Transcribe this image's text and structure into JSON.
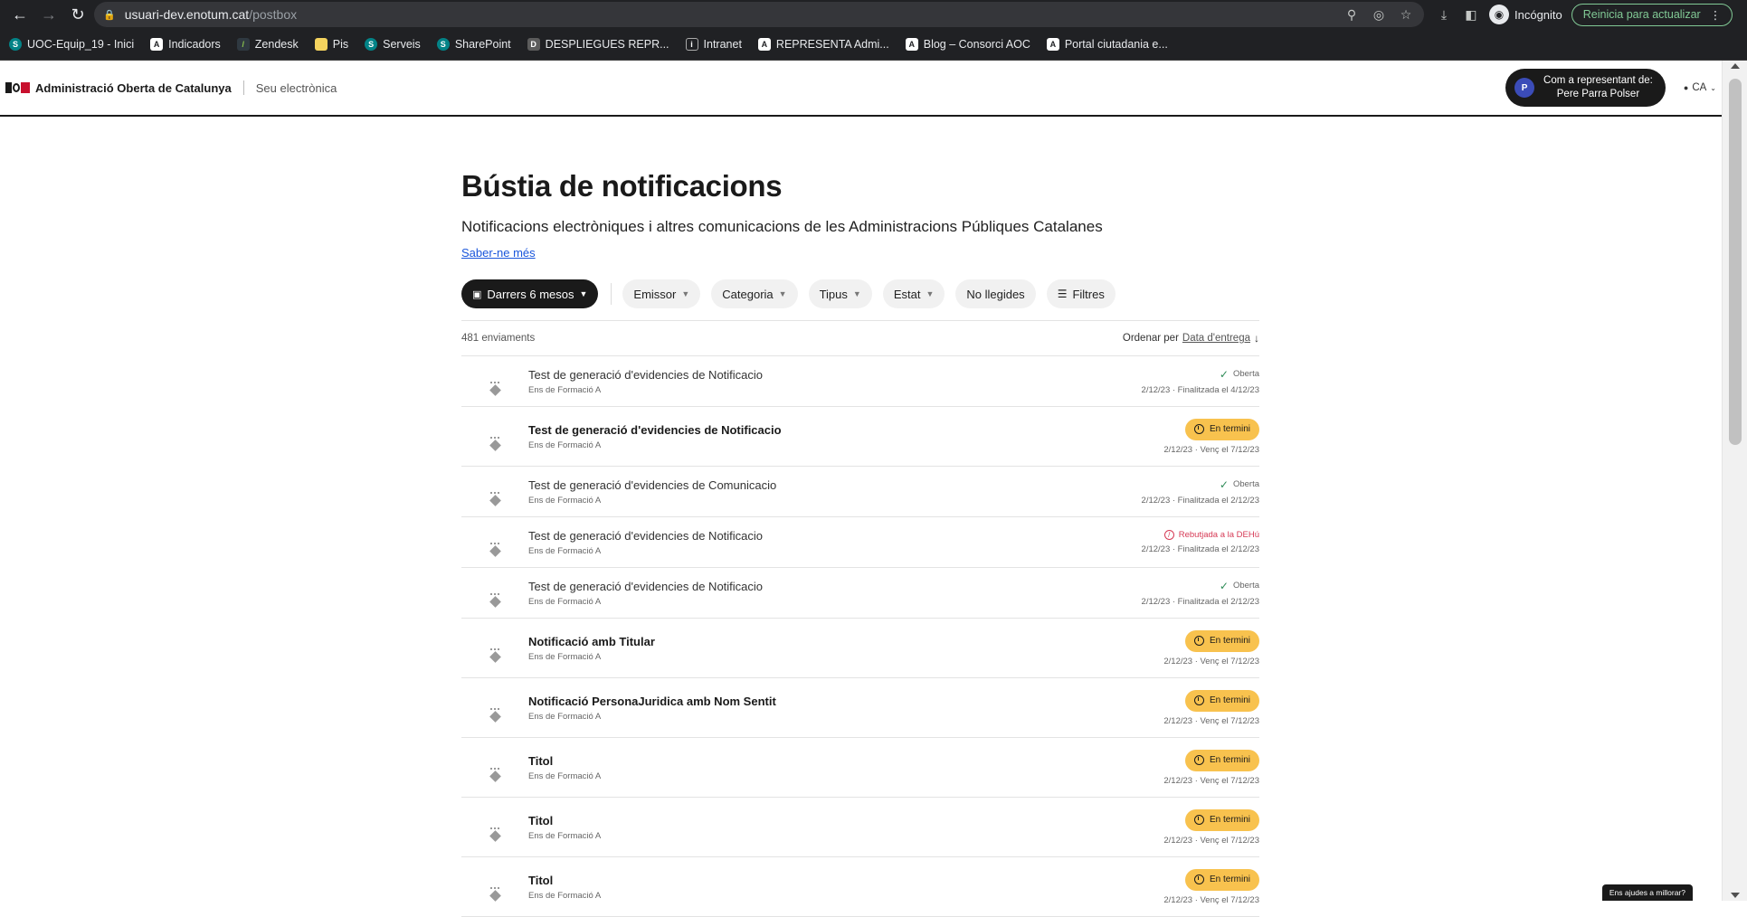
{
  "browser": {
    "url_host": "usuari-dev.enotum.cat",
    "url_path": "/postbox",
    "incognito_label": "Incógnito",
    "update_label": "Reinicia para actualizar",
    "bookmarks": [
      {
        "label": "UOC-Equip_19 - Inici",
        "icon": "sharepoint-icon"
      },
      {
        "label": "Indicadors",
        "icon": "aoc-icon"
      },
      {
        "label": "Zendesk",
        "icon": "zendesk-icon"
      },
      {
        "label": "Pis",
        "icon": "folder-icon"
      },
      {
        "label": "Serveis",
        "icon": "sharepoint-icon"
      },
      {
        "label": "SharePoint",
        "icon": "sharepoint-icon"
      },
      {
        "label": "DESPLIEGUES REPR...",
        "icon": "despliegues-icon"
      },
      {
        "label": "Intranet",
        "icon": "intranet-icon"
      },
      {
        "label": "REPRESENTA Admi...",
        "icon": "aoc-icon"
      },
      {
        "label": "Blog – Consorci AOC",
        "icon": "aoc-icon"
      },
      {
        "label": "Portal ciutadania e...",
        "icon": "aoc-icon"
      }
    ]
  },
  "header": {
    "org_name": "Administració Oberta de Catalunya",
    "org_sub": "Seu electrònica",
    "rep_line1": "Com a representant de:",
    "rep_line2": "Pere Parra Polser",
    "avatar_initial": "P",
    "lang": "CA"
  },
  "main": {
    "title": "Bústia de notificacions",
    "subtitle": "Notificacions electròniques i altres comunicacions de les Administracions Públiques Catalanes",
    "more_link": "Saber-ne més",
    "filters": {
      "period": "Darrers 6 mesos",
      "emissor": "Emissor",
      "categoria": "Categoria",
      "tipus": "Tipus",
      "estat": "Estat",
      "unread": "No llegides",
      "more": "Filtres"
    },
    "count": "481 enviaments",
    "sort_label": "Ordenar per",
    "sort_field": "Data d'entrega"
  },
  "items": [
    {
      "title": "Test de generació d'evidencies de Notificacio",
      "sender": "Ens de Formació A",
      "status": "Oberta",
      "status_type": "open",
      "date": "2/12/23 · Finalitzada el 4/12/23",
      "unread": false
    },
    {
      "title": "Test de generació d'evidencies de Notificacio",
      "sender": "Ens de Formació A",
      "status": "En termini",
      "status_type": "term",
      "date": "2/12/23 · Venç el 7/12/23",
      "unread": true
    },
    {
      "title": "Test de generació d'evidencies de Comunicacio",
      "sender": "Ens de Formació A",
      "status": "Oberta",
      "status_type": "open",
      "date": "2/12/23 · Finalitzada el 2/12/23",
      "unread": false
    },
    {
      "title": "Test de generació d'evidencies de Notificacio",
      "sender": "Ens de Formació A",
      "status": "Rebutjada a la DEHú",
      "status_type": "rejected",
      "date": "2/12/23 · Finalitzada el 2/12/23",
      "unread": false
    },
    {
      "title": "Test de generació d'evidencies de Notificacio",
      "sender": "Ens de Formació A",
      "status": "Oberta",
      "status_type": "open",
      "date": "2/12/23 · Finalitzada el 2/12/23",
      "unread": false
    },
    {
      "title": "Notificació amb Titular",
      "sender": "Ens de Formació A",
      "status": "En termini",
      "status_type": "term",
      "date": "2/12/23 · Venç el 7/12/23",
      "unread": true
    },
    {
      "title": "Notificació PersonaJuridica amb Nom Sentit",
      "sender": "Ens de Formació A",
      "status": "En termini",
      "status_type": "term",
      "date": "2/12/23 · Venç el 7/12/23",
      "unread": true
    },
    {
      "title": "Titol",
      "sender": "Ens de Formació A",
      "status": "En termini",
      "status_type": "term",
      "date": "2/12/23 · Venç el 7/12/23",
      "unread": true
    },
    {
      "title": "Titol",
      "sender": "Ens de Formació A",
      "status": "En termini",
      "status_type": "term",
      "date": "2/12/23 · Venç el 7/12/23",
      "unread": true
    },
    {
      "title": "Titol",
      "sender": "Ens de Formació A",
      "status": "En termini",
      "status_type": "term",
      "date": "2/12/23 · Venç el 7/12/23",
      "unread": true
    }
  ],
  "feedback": "Ens ajudes a millorar?"
}
